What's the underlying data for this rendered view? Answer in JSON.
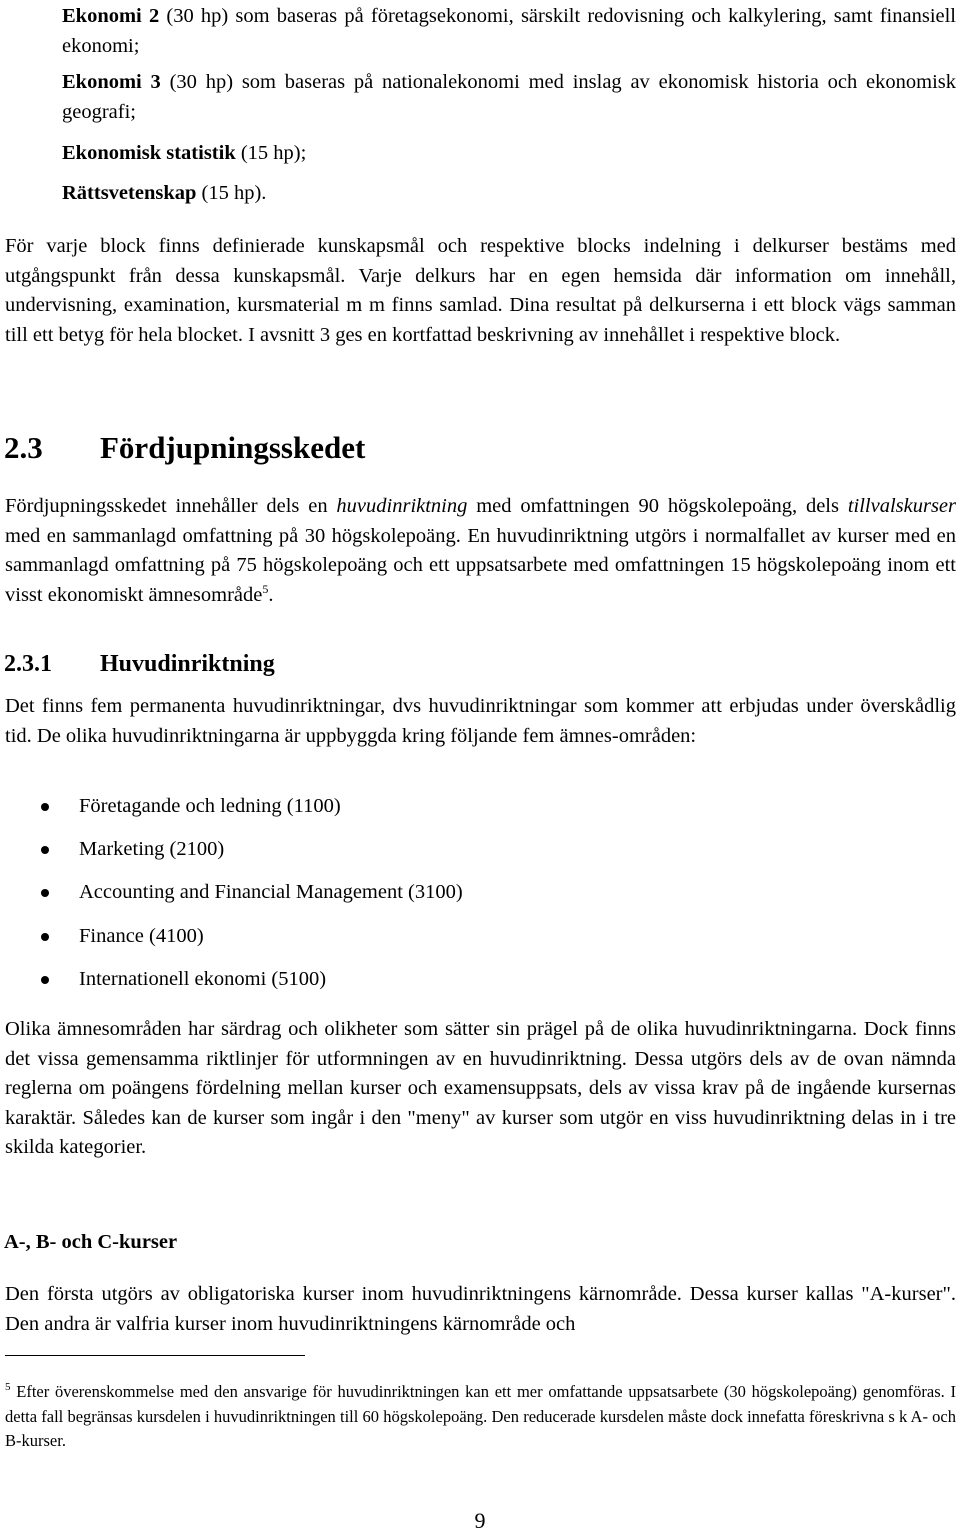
{
  "document": {
    "block_list": [
      {
        "name": "Ekonomi 2",
        "rest": " (30 hp) som baseras på företagsekonomi, särskilt redovisning och kalkylering, samt finansiell ekonomi;"
      },
      {
        "name": "Ekonomi 3",
        "rest": " (30 hp) som baseras på nationalekonomi med inslag av ekonomisk historia och ekonomisk geografi;"
      },
      {
        "name": "Ekonomisk statistik",
        "rest": " (15 hp);"
      },
      {
        "name": "Rättsvetenskap",
        "rest": " (15 hp)."
      }
    ],
    "intro_paragraph": "För varje block finns definierade kunskapsmål och respektive blocks indelning i delkurser bestäms med utgångspunkt från dessa kunskapsmål. Varje delkurs har en egen hemsida där information om innehåll, undervisning, examination, kursmaterial m m finns samlad. Dina resultat på delkurserna i ett block vägs samman till ett betyg för hela blocket. I avsnitt 3 ges en kortfattad beskrivning av innehållet i respektive block.",
    "section_2_3": {
      "number": "2.3",
      "title": "Fördjupningsskedet",
      "paragraph": {
        "part1": "Fördjupningsskedet innehåller dels en ",
        "em1": "huvudinriktning",
        "part2": " med omfattningen 90 högskolepoäng, dels ",
        "em2": "tillvalskurser",
        "part3": " med en sammanlagd omfattning på 30 högskolepoäng. En huvudinriktning utgörs i normalfallet av kurser med en sammanlagd omfattning på 75 högskolepoäng och ett uppsatsarbete med omfattningen 15 högskolepoäng inom ett visst ekonomiskt ämnesområde",
        "footnote_ref": "5",
        "end": "."
      }
    },
    "section_2_3_1": {
      "number": "2.3.1",
      "title": "Huvudinriktning",
      "paragraph": "Det finns fem permanenta huvudinriktningar, dvs huvudinriktningar som kommer att erbjudas under överskådlig tid. De olika huvudinriktningarna är uppbyggda kring följande fem ämnes-områden:",
      "areas": [
        "Företagande och ledning (1100)",
        "Marketing (2100)",
        "Accounting and Financial Management (3100)",
        "Finance (4100)",
        "Internationell ekonomi (5100)"
      ],
      "paragraph2": "Olika ämnesområden har särdrag och olikheter som sätter sin prägel på de olika huvudinriktningarna. Dock finns det vissa gemensamma riktlinjer för utformningen av en huvudinriktning. Dessa utgörs dels av de ovan nämnda reglerna om poängens fördelning mellan kurser och examensuppsats, dels av vissa krav på de ingående kursernas karaktär. Således kan de kurser som ingår i den \"meny\" av kurser som utgör en viss huvudinriktning delas in i tre skilda kategorier."
    },
    "subheading_abc": {
      "title": "A-, B- och C-kurser",
      "paragraph": "Den första utgörs av obligatoriska kurser inom huvudinriktningens kärnområde. Dessa kurser kallas \"A-kurser\". Den andra är valfria kurser inom huvudinriktningens kärnområde och"
    },
    "footnote": {
      "marker": "5",
      "text": " Efter överenskommelse med den ansvarige för huvudinriktningen kan ett mer omfattande uppsatsarbete (30 högskolepoäng) genomföras. I detta fall begränsas kursdelen i huvudinriktningen till 60 högskolepoäng. Den reducerade kursdelen måste dock innefatta föreskrivna s k A- och B-kurser."
    },
    "page_number": "9"
  }
}
